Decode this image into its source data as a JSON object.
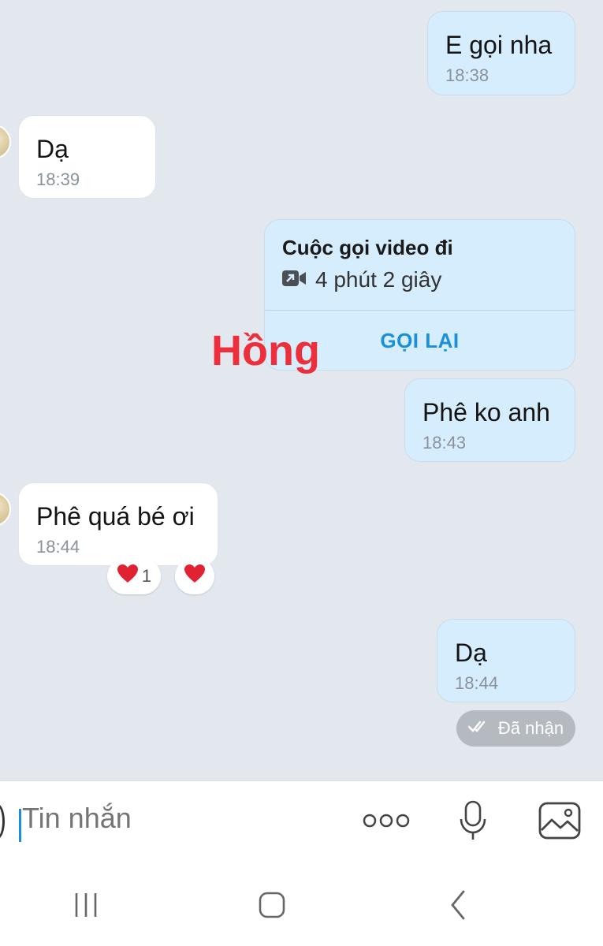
{
  "messages": [
    {
      "dir": "out",
      "text": "E gọi nha",
      "time": "18:38"
    },
    {
      "dir": "in",
      "text": "Dạ",
      "time": "18:39"
    },
    {
      "dir": "out",
      "text": "Phê ko anh",
      "time": "18:43"
    },
    {
      "dir": "in",
      "text": "Phê quá bé ơi",
      "time": "18:44"
    },
    {
      "dir": "out",
      "text": "Dạ",
      "time": "18:44"
    }
  ],
  "call": {
    "title": "Cuộc gọi video đi",
    "duration": "4 phút 2 giây",
    "action": "GỌI LẠI",
    "icon": "video-call-icon"
  },
  "watermark": "Hồng",
  "reactions": [
    {
      "emoji": "❤️",
      "count": "1"
    },
    {
      "emoji": "❤️",
      "count": ""
    }
  ],
  "status": {
    "text": "Đã nhận",
    "icon": "double-check-icon"
  },
  "composer": {
    "placeholder": "Tin nhắn"
  },
  "colors": {
    "outgoing_bubble": "#d5edfd",
    "incoming_bubble": "#ffffff",
    "accent": "#1a8fdc",
    "watermark": "#ec2f3b"
  }
}
